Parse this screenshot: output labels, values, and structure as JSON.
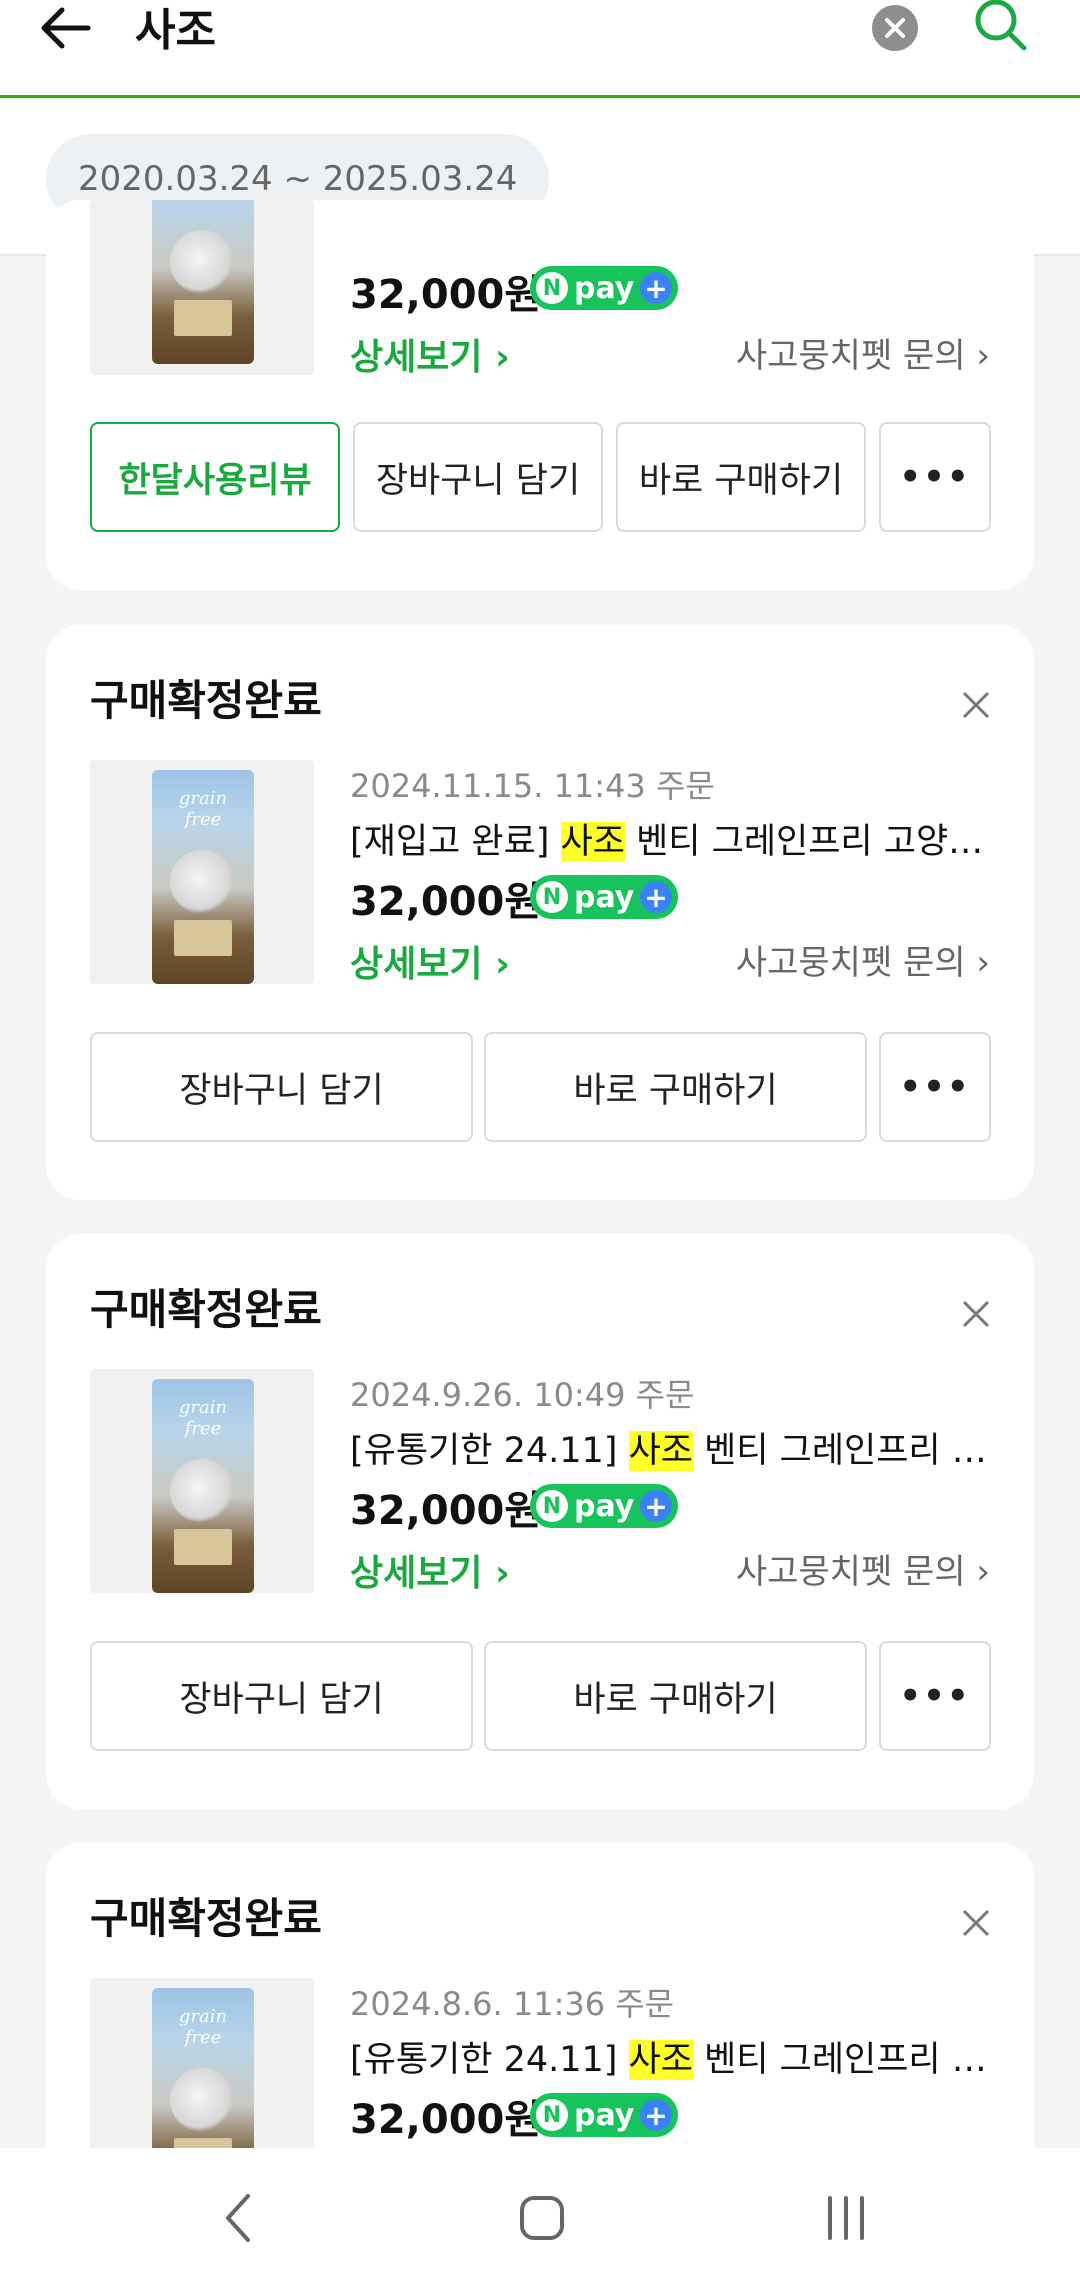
{
  "header": {
    "query": "사조"
  },
  "filter": {
    "date_range": "2020.03.24 ~ 2025.03.24"
  },
  "cards": [
    {
      "price": "32,000원",
      "detail": "상세보기 ›",
      "inquiry": "사고뭉치펫 문의 ›",
      "buttons": [
        "한달사용리뷰",
        "장바구니 담기",
        "바로 구매하기",
        "•••"
      ]
    },
    {
      "status": "구매확정완료",
      "order_date": "2024.11.15. 11:43 주문",
      "name_prefix": "[재입고 완료] ",
      "name_highlight": "사조",
      "name_suffix": " 벤티 그레인프리 고양…",
      "price": "32,000원",
      "detail": "상세보기 ›",
      "inquiry": "사고뭉치펫 문의 ›",
      "buttons": [
        "장바구니 담기",
        "바로 구매하기",
        "•••"
      ]
    },
    {
      "status": "구매확정완료",
      "order_date": "2024.9.26. 10:49 주문",
      "name_prefix": "[유통기한 24.11] ",
      "name_highlight": "사조",
      "name_suffix": " 벤티 그레인프리 …",
      "price": "32,000원",
      "detail": "상세보기 ›",
      "inquiry": "사고뭉치펫 문의 ›",
      "buttons": [
        "장바구니 담기",
        "바로 구매하기",
        "•••"
      ]
    },
    {
      "status": "구매확정완료",
      "order_date": "2024.8.6. 11:36 주문",
      "name_prefix": "[유통기한 24.11] ",
      "name_highlight": "사조",
      "name_suffix": " 벤티 그레인프리 …",
      "price": "32,000원"
    }
  ],
  "npay": {
    "n": "N",
    "label": "pay",
    "plus": "+"
  },
  "thumb_brand": "grain free",
  "colors": {
    "accent_green": "#1aa93e",
    "npay_green": "#16c45b",
    "highlight": "#ffff2a"
  }
}
